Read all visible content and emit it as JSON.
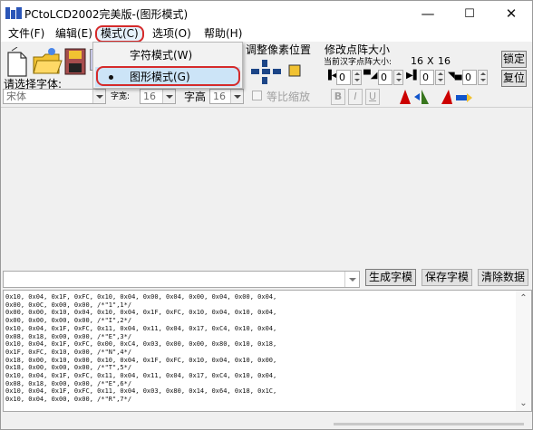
{
  "window": {
    "title": "PCtoLCD2002完美版-(图形模式)",
    "controls": {
      "minimize": "—",
      "maximize": "☐",
      "close": "✕"
    }
  },
  "menu": [
    {
      "label": "文件(F)"
    },
    {
      "label": "编辑(E)"
    },
    {
      "label": "模式(C)"
    },
    {
      "label": "选项(O)"
    },
    {
      "label": "帮助(H)"
    }
  ],
  "mode_dropdown": {
    "items": [
      {
        "label": "字符模式(W)"
      },
      {
        "label": "图形模式(G)"
      }
    ],
    "selected": "图形模式(G)"
  },
  "toolbar": {
    "font_label": "请选择字体:",
    "font_value": "宋体",
    "width_label": "字宽:",
    "width_value": "16",
    "height_label": "字高",
    "height_value": "16",
    "proportional_label": "等比缩放",
    "bold": "B",
    "italic": "I",
    "underline": "U",
    "adjust_label": "调整像素位置",
    "resize_label": "修改点阵大小",
    "current_label": "当前汉字点阵大小:",
    "current_w": "16",
    "current_x": "X",
    "current_h": "16",
    "lock_label": "锁定",
    "reset_label": "复位",
    "spin_values": [
      "0",
      "0",
      "0",
      "0"
    ]
  },
  "actions": {
    "generate": "生成字模",
    "save": "保存字模",
    "clear": "清除数据"
  },
  "output_lines": [
    "0x10, 0x04, 0x1F, 0xFC, 0x10, 0x04, 0x00, 0x04, 0x00, 0x04, 0x00, 0x04,",
    "0x00, 0x0C, 0x00, 0x00, /*\"1\",1*/",
    "0x00, 0x00, 0x10, 0x04, 0x10, 0x04, 0x1F, 0xFC, 0x10, 0x04, 0x10, 0x04,",
    "0x00, 0x00, 0x00, 0x00, /*\"I\",2*/",
    "0x10, 0x04, 0x1F, 0xFC, 0x11, 0x04, 0x11, 0x04, 0x17, 0xC4, 0x10, 0x04,",
    "0x08, 0x18, 0x00, 0x00, /*\"E\",3*/",
    "0x10, 0x04, 0x1F, 0xFC, 0x00, 0xC4, 0x03, 0x00, 0x00, 0x80, 0x10, 0x18,",
    "0x1F, 0xFC, 0x10, 0x00, /*\"N\",4*/",
    "0x18, 0x00, 0x10, 0x00, 0x10, 0x04, 0x1F, 0xFC, 0x10, 0x04, 0x10, 0x00,",
    "0x18, 0x00, 0x00, 0x00, /*\"T\",5*/",
    "0x10, 0x04, 0x1F, 0xFC, 0x11, 0x04, 0x11, 0x04, 0x17, 0xC4, 0x10, 0x04,",
    "0x08, 0x18, 0x00, 0x00, /*\"E\",6*/",
    "0x10, 0x04, 0x1F, 0xFC, 0x11, 0x04, 0x03, 0x80, 0x14, 0x64, 0x18, 0x1C,",
    "0x10, 0x04, 0x00, 0x00, /*\"R\",7*/"
  ],
  "colors": {
    "highlight_ring": "#d52b2b",
    "menu_hover": "#e5f1fb",
    "selected_item": "#cce4f7",
    "icon_blue": "#2b56b8"
  }
}
